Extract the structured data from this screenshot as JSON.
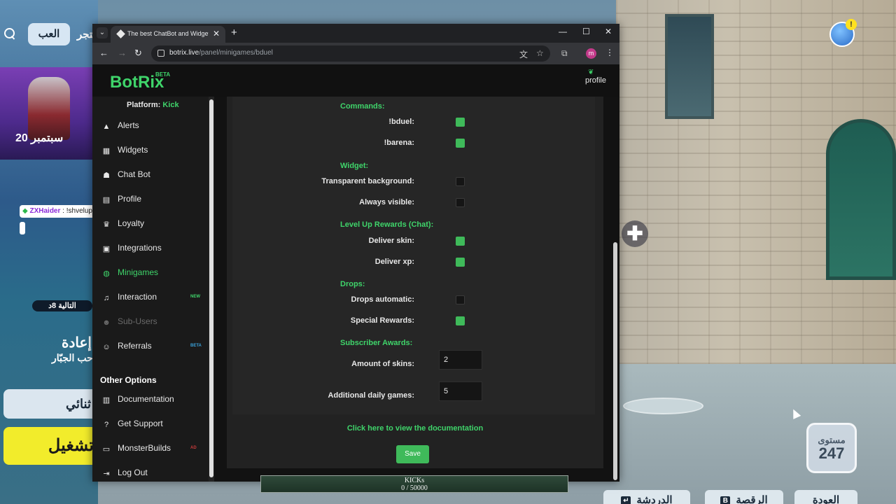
{
  "browser": {
    "tab_title": "The best ChatBot and Widgets",
    "url_host": "botrix.live",
    "url_path": "/panel/minigames/bduel",
    "profile_initial": "m"
  },
  "app": {
    "logo": "BotRix",
    "logo_badge": "BETA",
    "profile_label": "profile",
    "platform_label": "Platform:",
    "platform_value": "Kick"
  },
  "sidebar": {
    "items": [
      {
        "label": "Alerts",
        "icon": "warning-icon"
      },
      {
        "label": "Widgets",
        "icon": "grid-icon"
      },
      {
        "label": "Chat Bot",
        "icon": "robot-icon"
      },
      {
        "label": "Profile",
        "icon": "id-card-icon"
      },
      {
        "label": "Loyalty",
        "icon": "trophy-icon"
      },
      {
        "label": "Integrations",
        "icon": "plug-icon"
      },
      {
        "label": "Minigames",
        "icon": "gamepad-icon"
      },
      {
        "label": "Interaction",
        "icon": "music-icon",
        "badge": "NEW"
      },
      {
        "label": "Sub-Users",
        "icon": "users-icon"
      },
      {
        "label": "Referrals",
        "icon": "referral-icon",
        "badge": "BETA"
      }
    ],
    "other_title": "Other Options",
    "other_items": [
      {
        "label": "Documentation",
        "icon": "document-icon"
      },
      {
        "label": "Get Support",
        "icon": "question-icon"
      },
      {
        "label": "MonsterBuilds",
        "icon": "monitor-icon",
        "badge": "AD"
      },
      {
        "label": "Log Out",
        "icon": "logout-icon"
      }
    ]
  },
  "settings": {
    "commands_title": "Commands:",
    "commands": [
      {
        "label": "!bduel:",
        "checked": true
      },
      {
        "label": "!barena:",
        "checked": true
      }
    ],
    "widget_title": "Widget:",
    "widget": [
      {
        "label": "Transparent background:",
        "checked": false
      },
      {
        "label": "Always visible:",
        "checked": false
      }
    ],
    "levelup_title": "Level Up Rewards (Chat):",
    "levelup": [
      {
        "label": "Deliver skin:",
        "checked": true
      },
      {
        "label": "Deliver xp:",
        "checked": true
      }
    ],
    "drops_title": "Drops:",
    "drops": [
      {
        "label": "Drops automatic:",
        "checked": false
      },
      {
        "label": "Special Rewards:",
        "checked": true
      }
    ],
    "subscriber_title": "Subscriber Awards:",
    "amount_of_skins_label": "Amount of skins:",
    "amount_of_skins_value": "2",
    "daily_games_label": "Additional daily games:",
    "daily_games_value": "5",
    "doc_link": "Click here to view the documentation",
    "save_label": "Save"
  },
  "game": {
    "tab_play": "العب",
    "tab_store": "متجر",
    "hero_text": "20 سبتمبر",
    "chat_user": "ZXHaider",
    "chat_sep": ":",
    "chat_message": "!shvelup",
    "next_badge": "التالية 8د",
    "mode_title": "إعادة",
    "mode_sub": "ساحب الجبّار",
    "duo_button": "ثنائي",
    "play_button": "تشغيل",
    "level_label": "مستوى",
    "level_value": "247",
    "bottom_tabs": [
      {
        "label": "الدردشة",
        "key": "↵"
      },
      {
        "label": "الرقصة",
        "key": "B"
      },
      {
        "label": "العودة",
        "key": ""
      }
    ]
  },
  "kick_progress": {
    "label": "KICKs",
    "current": 0,
    "goal": 50000,
    "text": "0 / 50000",
    "fraction": 0
  }
}
